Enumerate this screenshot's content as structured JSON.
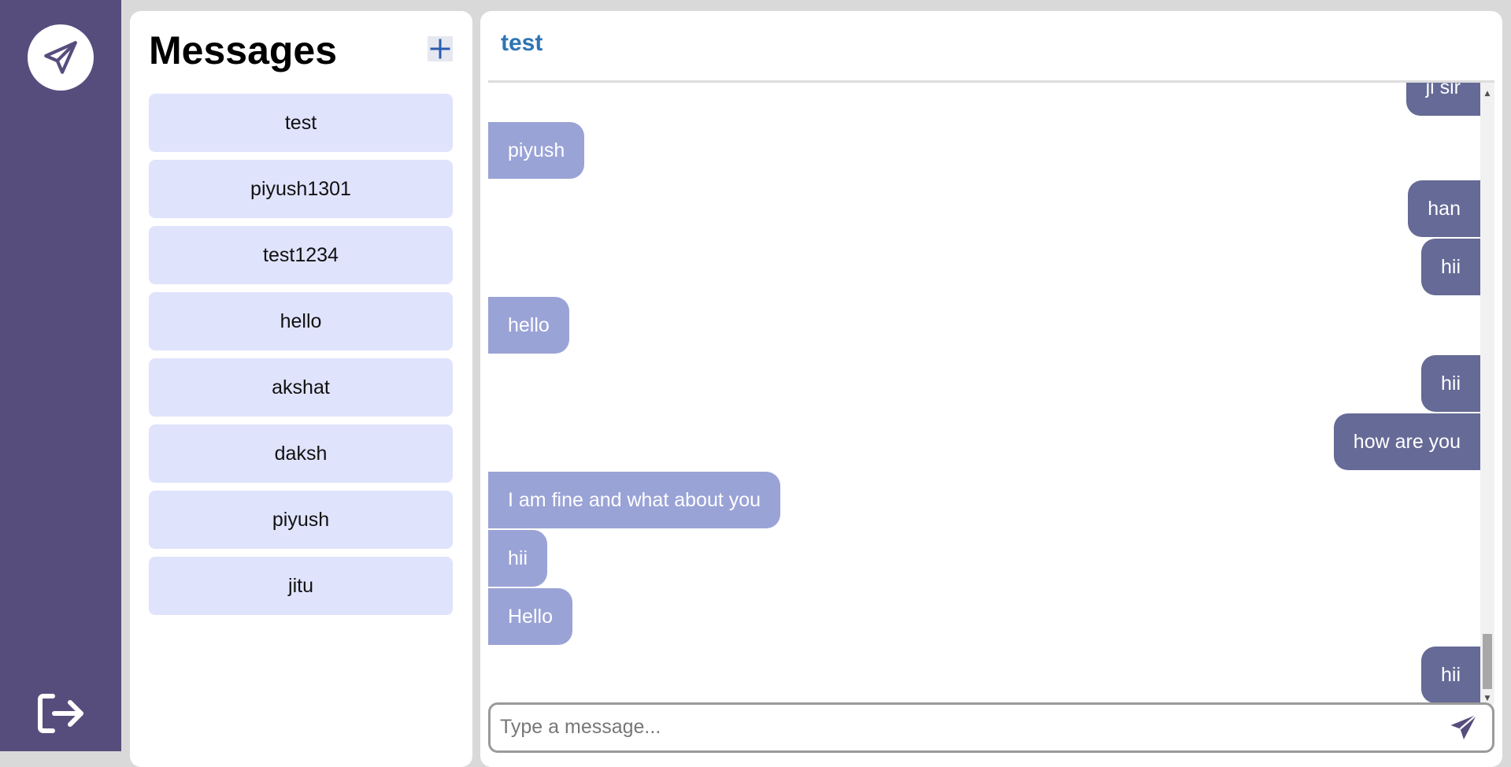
{
  "sidebar": {
    "logo_icon": "paper-plane-icon",
    "logout_icon": "logout-icon",
    "color": "#574d7d"
  },
  "conversations": {
    "title": "Messages",
    "add_icon": "plus-icon",
    "items": [
      {
        "label": "test"
      },
      {
        "label": "piyush1301"
      },
      {
        "label": "test1234"
      },
      {
        "label": "hello"
      },
      {
        "label": "akshat"
      },
      {
        "label": "daksh"
      },
      {
        "label": "piyush"
      },
      {
        "label": "jitu"
      }
    ]
  },
  "chat": {
    "title": "test",
    "messages": [
      {
        "text": "ji sir",
        "direction": "out"
      },
      {
        "text": "piyush",
        "direction": "in"
      },
      {
        "text": "han",
        "direction": "out"
      },
      {
        "text": "hii",
        "direction": "out"
      },
      {
        "text": "hello",
        "direction": "in"
      },
      {
        "text": "hii",
        "direction": "out"
      },
      {
        "text": "how are you",
        "direction": "out"
      },
      {
        "text": "I am fine and what about you",
        "direction": "in"
      },
      {
        "text": "hii",
        "direction": "in"
      },
      {
        "text": "Hello",
        "direction": "in"
      },
      {
        "text": "hii",
        "direction": "out"
      }
    ],
    "colors": {
      "incoming": "#9aa3d6",
      "outgoing": "#656a96",
      "title": "#2e74b5"
    }
  },
  "composer": {
    "placeholder": "Type a message...",
    "value": "",
    "send_icon": "send-icon"
  }
}
